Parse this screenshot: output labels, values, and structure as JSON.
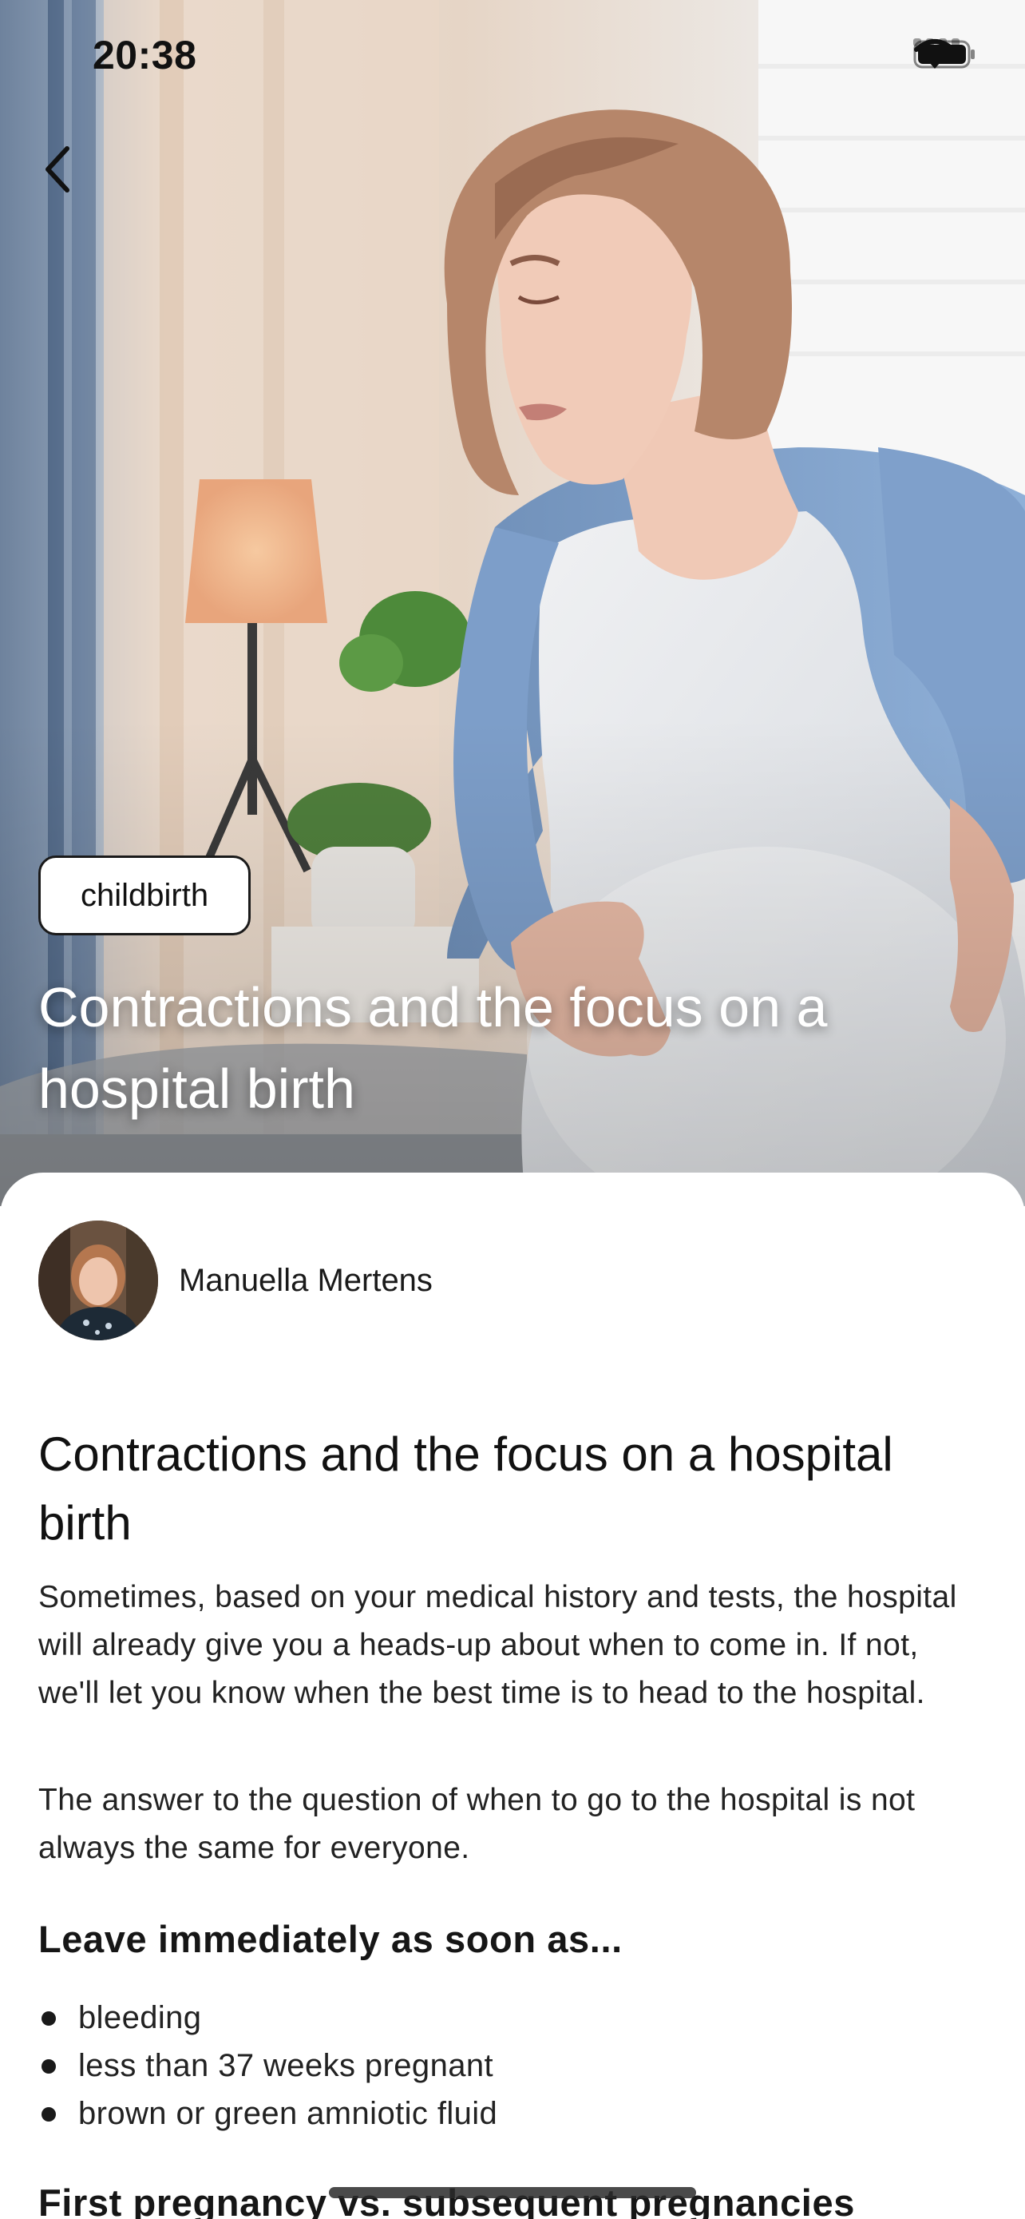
{
  "status_bar": {
    "time": "20:38"
  },
  "hero": {
    "tag": "childbirth",
    "title": "Contractions and the focus on a hospital birth",
    "image_icon": "photo-pregnant-woman"
  },
  "author": {
    "name": "Manuella Mertens"
  },
  "article": {
    "title": "Contractions and the focus on a hospital birth",
    "paragraphs": [
      "Sometimes, based on your medical history and tests, the hospital will already give you a heads-up about when to come in. If not, we'll let you know when the best time is to head to the hospital.",
      "The answer to the question of when to go to the hospital is not always the same for everyone."
    ],
    "section_heading": "Leave immediately as soon as...",
    "bullets": [
      "bleeding",
      "less than 37 weeks pregnant",
      "brown or green amniotic fluid"
    ],
    "next_heading": "First pregnancy vs. subsequent pregnancies"
  },
  "icons": {
    "back": "chevron-left-icon",
    "wifi": "wifi-icon",
    "battery": "battery-icon",
    "signal": "cellular-signal-icon"
  }
}
